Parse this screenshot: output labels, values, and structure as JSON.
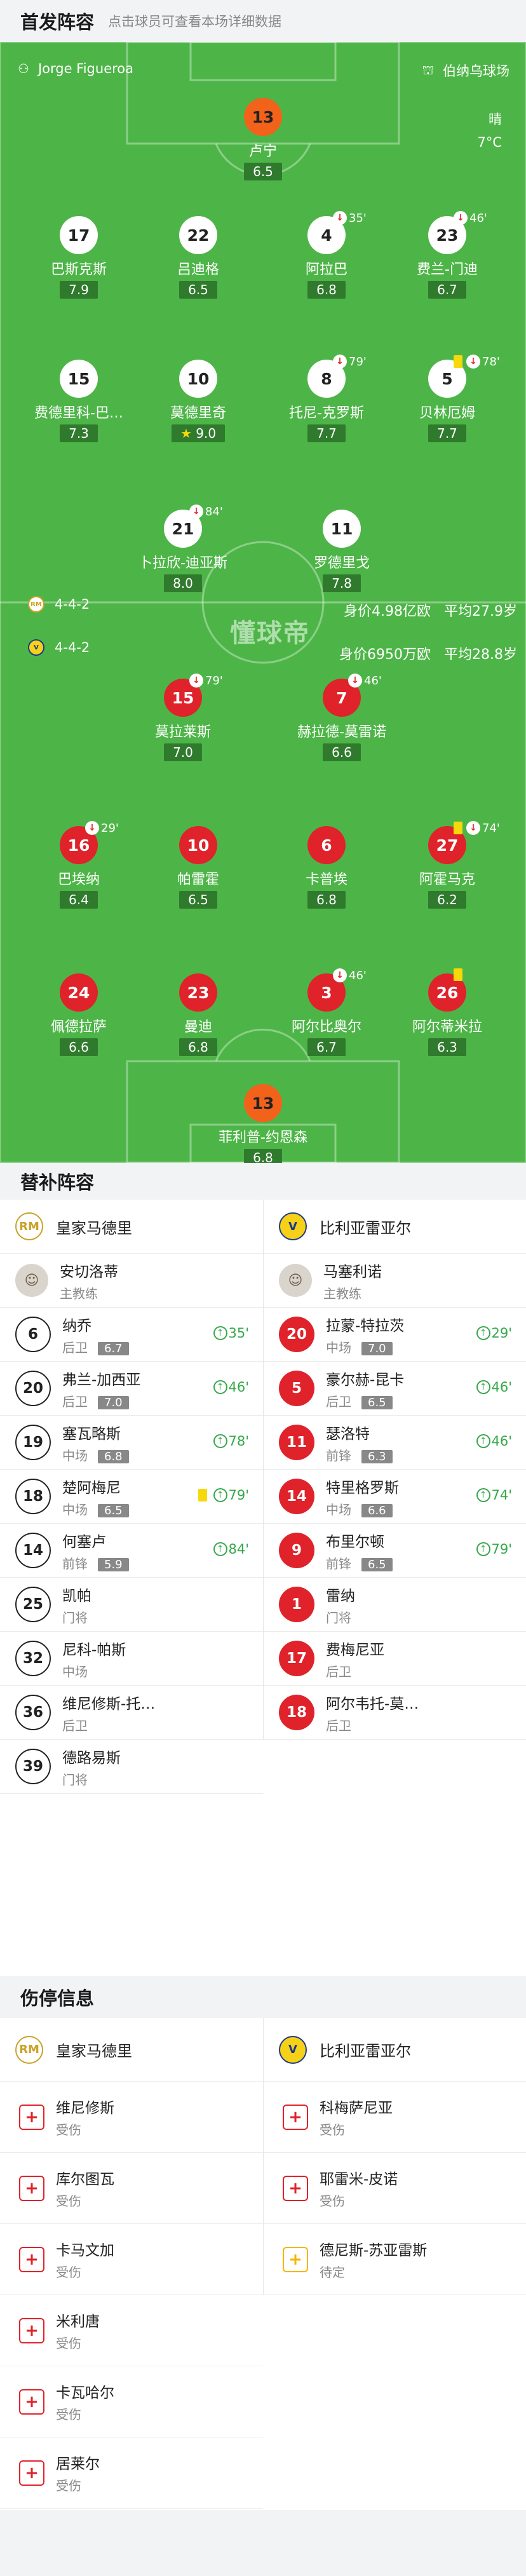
{
  "header": {
    "title": "首发阵容",
    "subtitle": "点击球员可查看本场详细数据"
  },
  "pitch": {
    "coach_left": "Jorge Figueroa",
    "stadium": "伯纳乌球场",
    "weather": "晴",
    "temperature": "7°C",
    "watermark": "懂球帝",
    "home": {
      "formation": "4-4-2",
      "value": "身价4.98亿欧",
      "age": "平均27.9岁"
    },
    "away": {
      "formation": "4-4-2",
      "value": "身价6950万欧",
      "age": "平均28.8岁"
    },
    "home_players": [
      {
        "num": "13",
        "name": "卢宁",
        "rating": "6.5"
      },
      {
        "num": "17",
        "name": "巴斯克斯",
        "rating": "7.9"
      },
      {
        "num": "22",
        "name": "吕迪格",
        "rating": "6.5"
      },
      {
        "num": "4",
        "name": "阿拉巴",
        "rating": "6.8",
        "sub": "35'"
      },
      {
        "num": "23",
        "name": "费兰-门迪",
        "rating": "6.7",
        "sub": "46'"
      },
      {
        "num": "15",
        "name": "费德里科-巴…",
        "rating": "7.3"
      },
      {
        "num": "10",
        "name": "莫德里奇",
        "rating": "9.0"
      },
      {
        "num": "8",
        "name": "托尼-克罗斯",
        "rating": "7.7",
        "sub": "79'"
      },
      {
        "num": "5",
        "name": "贝林厄姆",
        "rating": "7.7",
        "sub": "78'"
      },
      {
        "num": "21",
        "name": "卜拉欣-迪亚斯",
        "rating": "8.0",
        "sub": "84'"
      },
      {
        "num": "11",
        "name": "罗德里戈",
        "rating": "7.8"
      }
    ],
    "away_players": [
      {
        "num": "15",
        "name": "莫拉莱斯",
        "rating": "7.0",
        "sub": "79'"
      },
      {
        "num": "7",
        "name": "赫拉德-莫雷诺",
        "rating": "6.6",
        "sub": "46'"
      },
      {
        "num": "16",
        "name": "巴埃纳",
        "rating": "6.4",
        "sub": "29'"
      },
      {
        "num": "10",
        "name": "帕雷霍",
        "rating": "6.5"
      },
      {
        "num": "6",
        "name": "卡普埃",
        "rating": "6.8"
      },
      {
        "num": "27",
        "name": "阿霍马克",
        "rating": "6.2",
        "sub": "74'"
      },
      {
        "num": "24",
        "name": "佩德拉萨",
        "rating": "6.6"
      },
      {
        "num": "23",
        "name": "曼迪",
        "rating": "6.8"
      },
      {
        "num": "3",
        "name": "阿尔比奥尔",
        "rating": "6.7",
        "sub": "46'"
      },
      {
        "num": "26",
        "name": "阿尔蒂米拉",
        "rating": "6.3"
      },
      {
        "num": "13",
        "name": "菲利普-约恩森",
        "rating": "6.8"
      }
    ]
  },
  "subs": {
    "title": "替补阵容",
    "home_team": "皇家马德里",
    "away_team": "比利亚雷亚尔",
    "home_coach": {
      "name": "安切洛蒂",
      "role": "主教练"
    },
    "away_coach": {
      "name": "马塞利诺",
      "role": "主教练"
    },
    "home": [
      {
        "num": "6",
        "name": "纳乔",
        "pos": "后卫",
        "rating": "6.7",
        "in": "35'"
      },
      {
        "num": "20",
        "name": "弗兰-加西亚",
        "pos": "后卫",
        "rating": "7.0",
        "in": "46'"
      },
      {
        "num": "19",
        "name": "塞瓦略斯",
        "pos": "中场",
        "rating": "6.8",
        "in": "78'"
      },
      {
        "num": "18",
        "name": "楚阿梅尼",
        "pos": "中场",
        "rating": "6.5",
        "in": "79'"
      },
      {
        "num": "14",
        "name": "何塞卢",
        "pos": "前锋",
        "rating": "5.9",
        "in": "84'"
      },
      {
        "num": "25",
        "name": "凯帕",
        "pos": "门将"
      },
      {
        "num": "32",
        "name": "尼科-帕斯",
        "pos": "中场"
      },
      {
        "num": "36",
        "name": "维尼修斯-托…",
        "pos": "后卫"
      },
      {
        "num": "39",
        "name": "德路易斯",
        "pos": "门将"
      }
    ],
    "away": [
      {
        "num": "20",
        "name": "拉蒙-特拉茨",
        "pos": "中场",
        "rating": "7.0",
        "in": "29'"
      },
      {
        "num": "5",
        "name": "豪尔赫-昆卡",
        "pos": "后卫",
        "rating": "6.5",
        "in": "46'"
      },
      {
        "num": "11",
        "name": "瑟洛特",
        "pos": "前锋",
        "rating": "6.3",
        "in": "46'"
      },
      {
        "num": "14",
        "name": "特里格罗斯",
        "pos": "中场",
        "rating": "6.6",
        "in": "74'"
      },
      {
        "num": "9",
        "name": "布里尔顿",
        "pos": "前锋",
        "rating": "6.5",
        "in": "79'"
      },
      {
        "num": "1",
        "name": "雷纳",
        "pos": "门将"
      },
      {
        "num": "17",
        "name": "费梅尼亚",
        "pos": "后卫"
      },
      {
        "num": "18",
        "name": "阿尔韦托-莫…",
        "pos": "后卫"
      }
    ]
  },
  "injuries": {
    "title": "伤停信息",
    "home_team": "皇家马德里",
    "away_team": "比利亚雷亚尔",
    "home": [
      {
        "name": "维尼修斯",
        "status": "受伤"
      },
      {
        "name": "库尔图瓦",
        "status": "受伤"
      },
      {
        "name": "卡马文加",
        "status": "受伤"
      },
      {
        "name": "米利唐",
        "status": "受伤"
      },
      {
        "name": "卡瓦哈尔",
        "status": "受伤"
      },
      {
        "name": "居莱尔",
        "status": "受伤"
      }
    ],
    "away": [
      {
        "name": "科梅萨尼亚",
        "status": "受伤"
      },
      {
        "name": "耶雷米-皮诺",
        "status": "受伤"
      },
      {
        "name": "德尼斯-苏亚雷斯",
        "status": "待定"
      }
    ]
  }
}
